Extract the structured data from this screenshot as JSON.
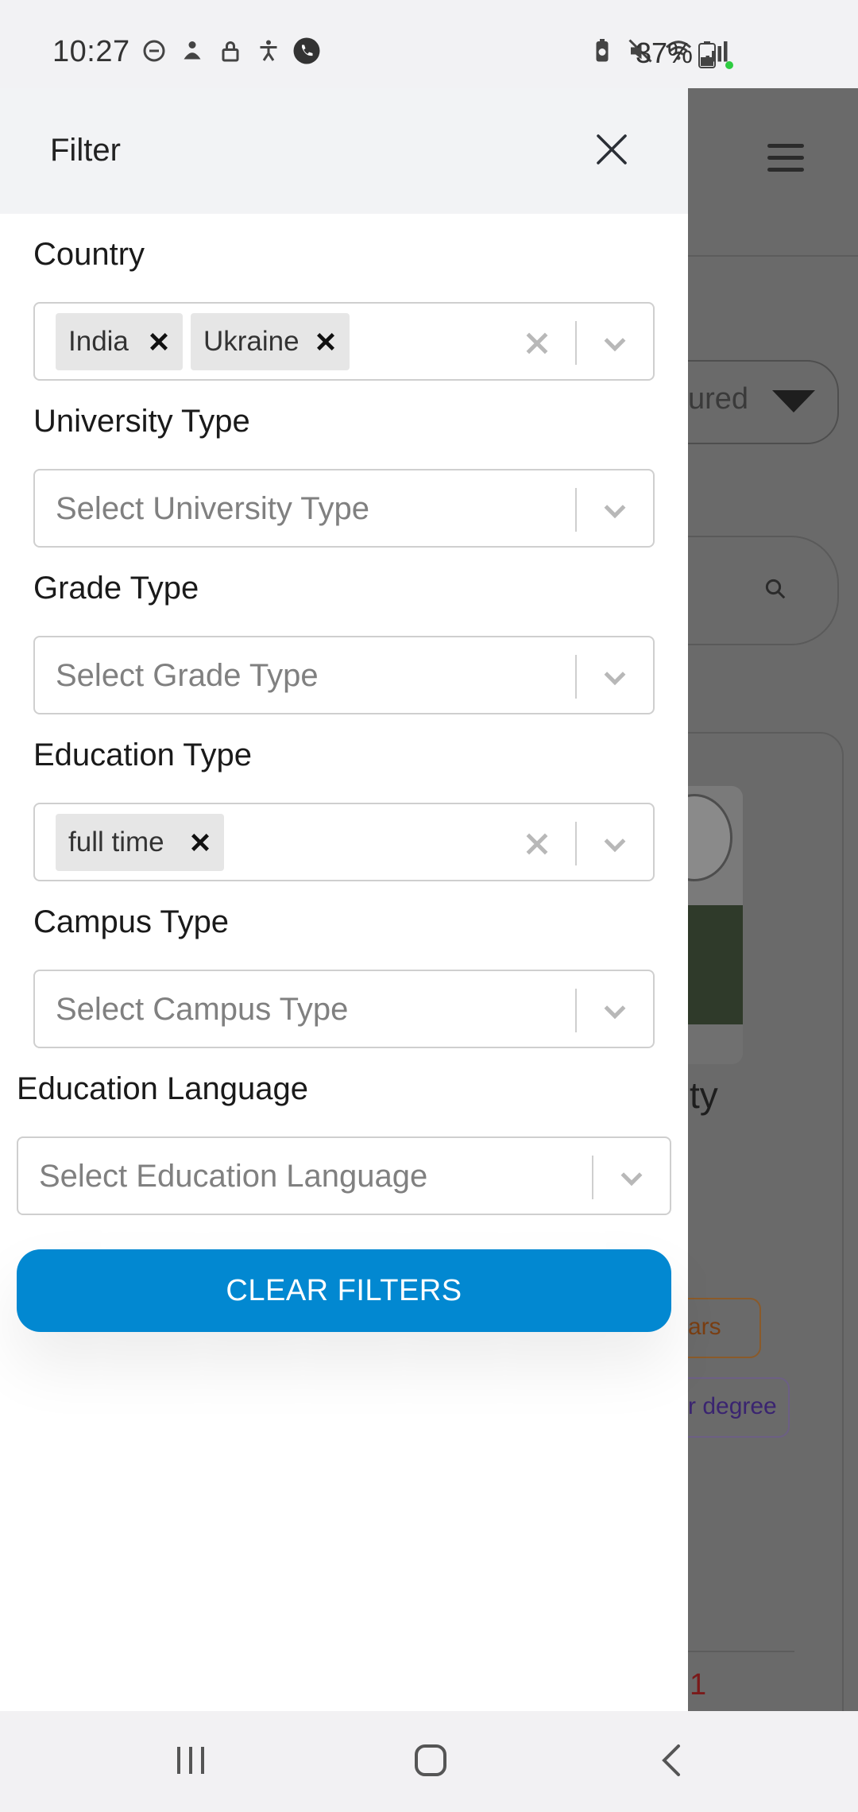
{
  "status_bar": {
    "time": "10:27",
    "battery": "37%"
  },
  "drawer": {
    "title": "Filter"
  },
  "filters": {
    "country": {
      "label": "Country",
      "chips": [
        "India",
        "Ukraine"
      ]
    },
    "university_type": {
      "label": "University Type",
      "placeholder": "Select University Type"
    },
    "grade_type": {
      "label": "Grade Type",
      "placeholder": "Select Grade Type"
    },
    "education_type": {
      "label": "Education Type",
      "chips": [
        "full time"
      ]
    },
    "campus_type": {
      "label": "Campus Type",
      "placeholder": "Select Campus Type"
    },
    "education_language": {
      "label": "Education Language",
      "placeholder": "Select Education Language"
    }
  },
  "clear_button": "CLEAR FILTERS",
  "background_page": {
    "sort_fragment": "ured",
    "title_fragment": "ty",
    "chip1_fragment": "ars",
    "chip2_fragment": "r degree",
    "number_fragment": "1"
  },
  "colors": {
    "accent": "#0288d1",
    "overlay": "#6a6a6a"
  }
}
